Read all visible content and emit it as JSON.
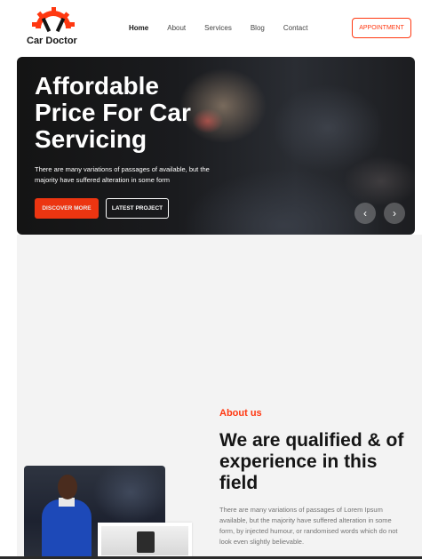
{
  "brand": {
    "name": "Car Doctor",
    "accent_color": "#ff3811"
  },
  "nav": {
    "items": [
      {
        "label": "Home",
        "active": true
      },
      {
        "label": "About"
      },
      {
        "label": "Services"
      },
      {
        "label": "Blog"
      },
      {
        "label": "Contact"
      }
    ],
    "appointment_label": "APPOINTMENT"
  },
  "hero": {
    "title": "Affordable Price For Car Servicing",
    "text": "There are many variations of passages of available, but the majority have suffered alteration in some form",
    "primary_button": "DISCOVER MORE",
    "secondary_button": "LATEST PROJECT",
    "prev_icon": "chevron-left-icon",
    "next_icon": "chevron-right-icon"
  },
  "about": {
    "label": "About us",
    "heading": "We are qualified & of experience in this field",
    "text": "There are many variations of passages of Lorem Ipsum available, but the majority have suffered alteration in some form, by injected humour, or randomised words which do not look even slightly believable."
  }
}
